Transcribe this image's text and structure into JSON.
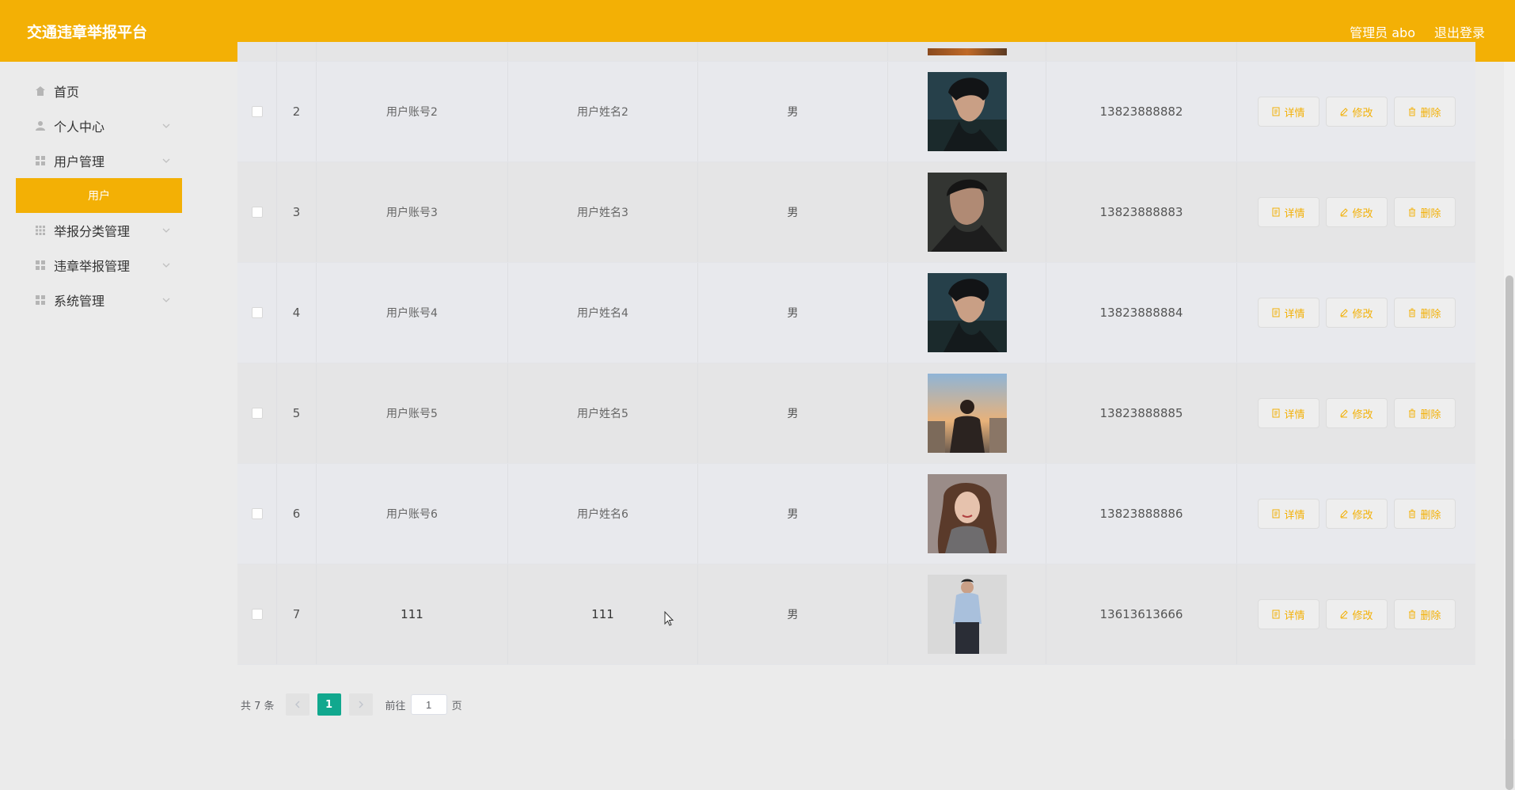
{
  "header": {
    "app_title": "交通违章举报平台",
    "user_label": "管理员 abo",
    "logout_label": "退出登录"
  },
  "sidebar": {
    "items": [
      {
        "label": "首页",
        "icon": "home-icon"
      },
      {
        "label": "个人中心",
        "icon": "user-icon"
      },
      {
        "label": "用户管理",
        "icon": "grid-icon"
      },
      {
        "label": "用户",
        "icon": ""
      },
      {
        "label": "举报分类管理",
        "icon": "grid-icon"
      },
      {
        "label": "违章举报管理",
        "icon": "grid-icon"
      },
      {
        "label": "系统管理",
        "icon": "grid-icon"
      }
    ]
  },
  "table": {
    "rows": [
      {
        "idx": "2",
        "account": "用户账号2",
        "name": "用户姓名2",
        "sex": "男",
        "phone": "13823888882"
      },
      {
        "idx": "3",
        "account": "用户账号3",
        "name": "用户姓名3",
        "sex": "男",
        "phone": "13823888883"
      },
      {
        "idx": "4",
        "account": "用户账号4",
        "name": "用户姓名4",
        "sex": "男",
        "phone": "13823888884"
      },
      {
        "idx": "5",
        "account": "用户账号5",
        "name": "用户姓名5",
        "sex": "男",
        "phone": "13823888885"
      },
      {
        "idx": "6",
        "account": "用户账号6",
        "name": "用户姓名6",
        "sex": "男",
        "phone": "13823888886"
      },
      {
        "idx": "7",
        "account": "111",
        "name": "111",
        "sex": "男",
        "phone": "13613613666"
      }
    ],
    "actions": {
      "detail": "详情",
      "edit": "修改",
      "delete": "删除"
    }
  },
  "pagination": {
    "total_text": "共 7 条",
    "current_page": "1",
    "goto_prefix": "前往",
    "goto_value": "1",
    "goto_suffix": "页"
  },
  "colors": {
    "accent": "#f3b005",
    "page_active": "#11a88e"
  }
}
